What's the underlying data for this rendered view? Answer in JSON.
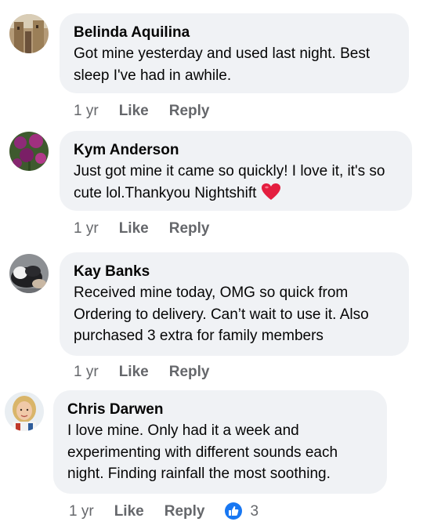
{
  "comments": [
    {
      "author": "Belinda Aquilina",
      "text": "Got mine yesterday and used last night. Best sleep I've had in awhile.",
      "time": "1 yr",
      "like_label": "Like",
      "reply_label": "Reply"
    },
    {
      "author": "Kym Anderson",
      "text": "Just got mine  it came so quickly! I love it, it's so cute lol.Thankyou Nightshift",
      "emoji": "red-heart",
      "time": "1 yr",
      "like_label": "Like",
      "reply_label": "Reply"
    },
    {
      "author": "Kay Banks",
      "text": "Received mine today, OMG so quick from Ordering to delivery. Can’t wait to use it. Also purchased 3 extra for family members",
      "time": "1 yr",
      "like_label": "Like",
      "reply_label": "Reply"
    },
    {
      "author": "Chris Darwen",
      "text": "I love mine. Only had it a week and experimenting with different sounds each night. Finding rainfall the most soothing.",
      "time": "1 yr",
      "like_label": "Like",
      "reply_label": "Reply",
      "reaction_icon": "thumbs-up-icon",
      "reaction_count": "3"
    }
  ],
  "colors": {
    "bubble": "#f0f2f5",
    "meta_text": "#65676b",
    "like_blue": "#1877f2",
    "heart_red": "#e41e3f"
  }
}
